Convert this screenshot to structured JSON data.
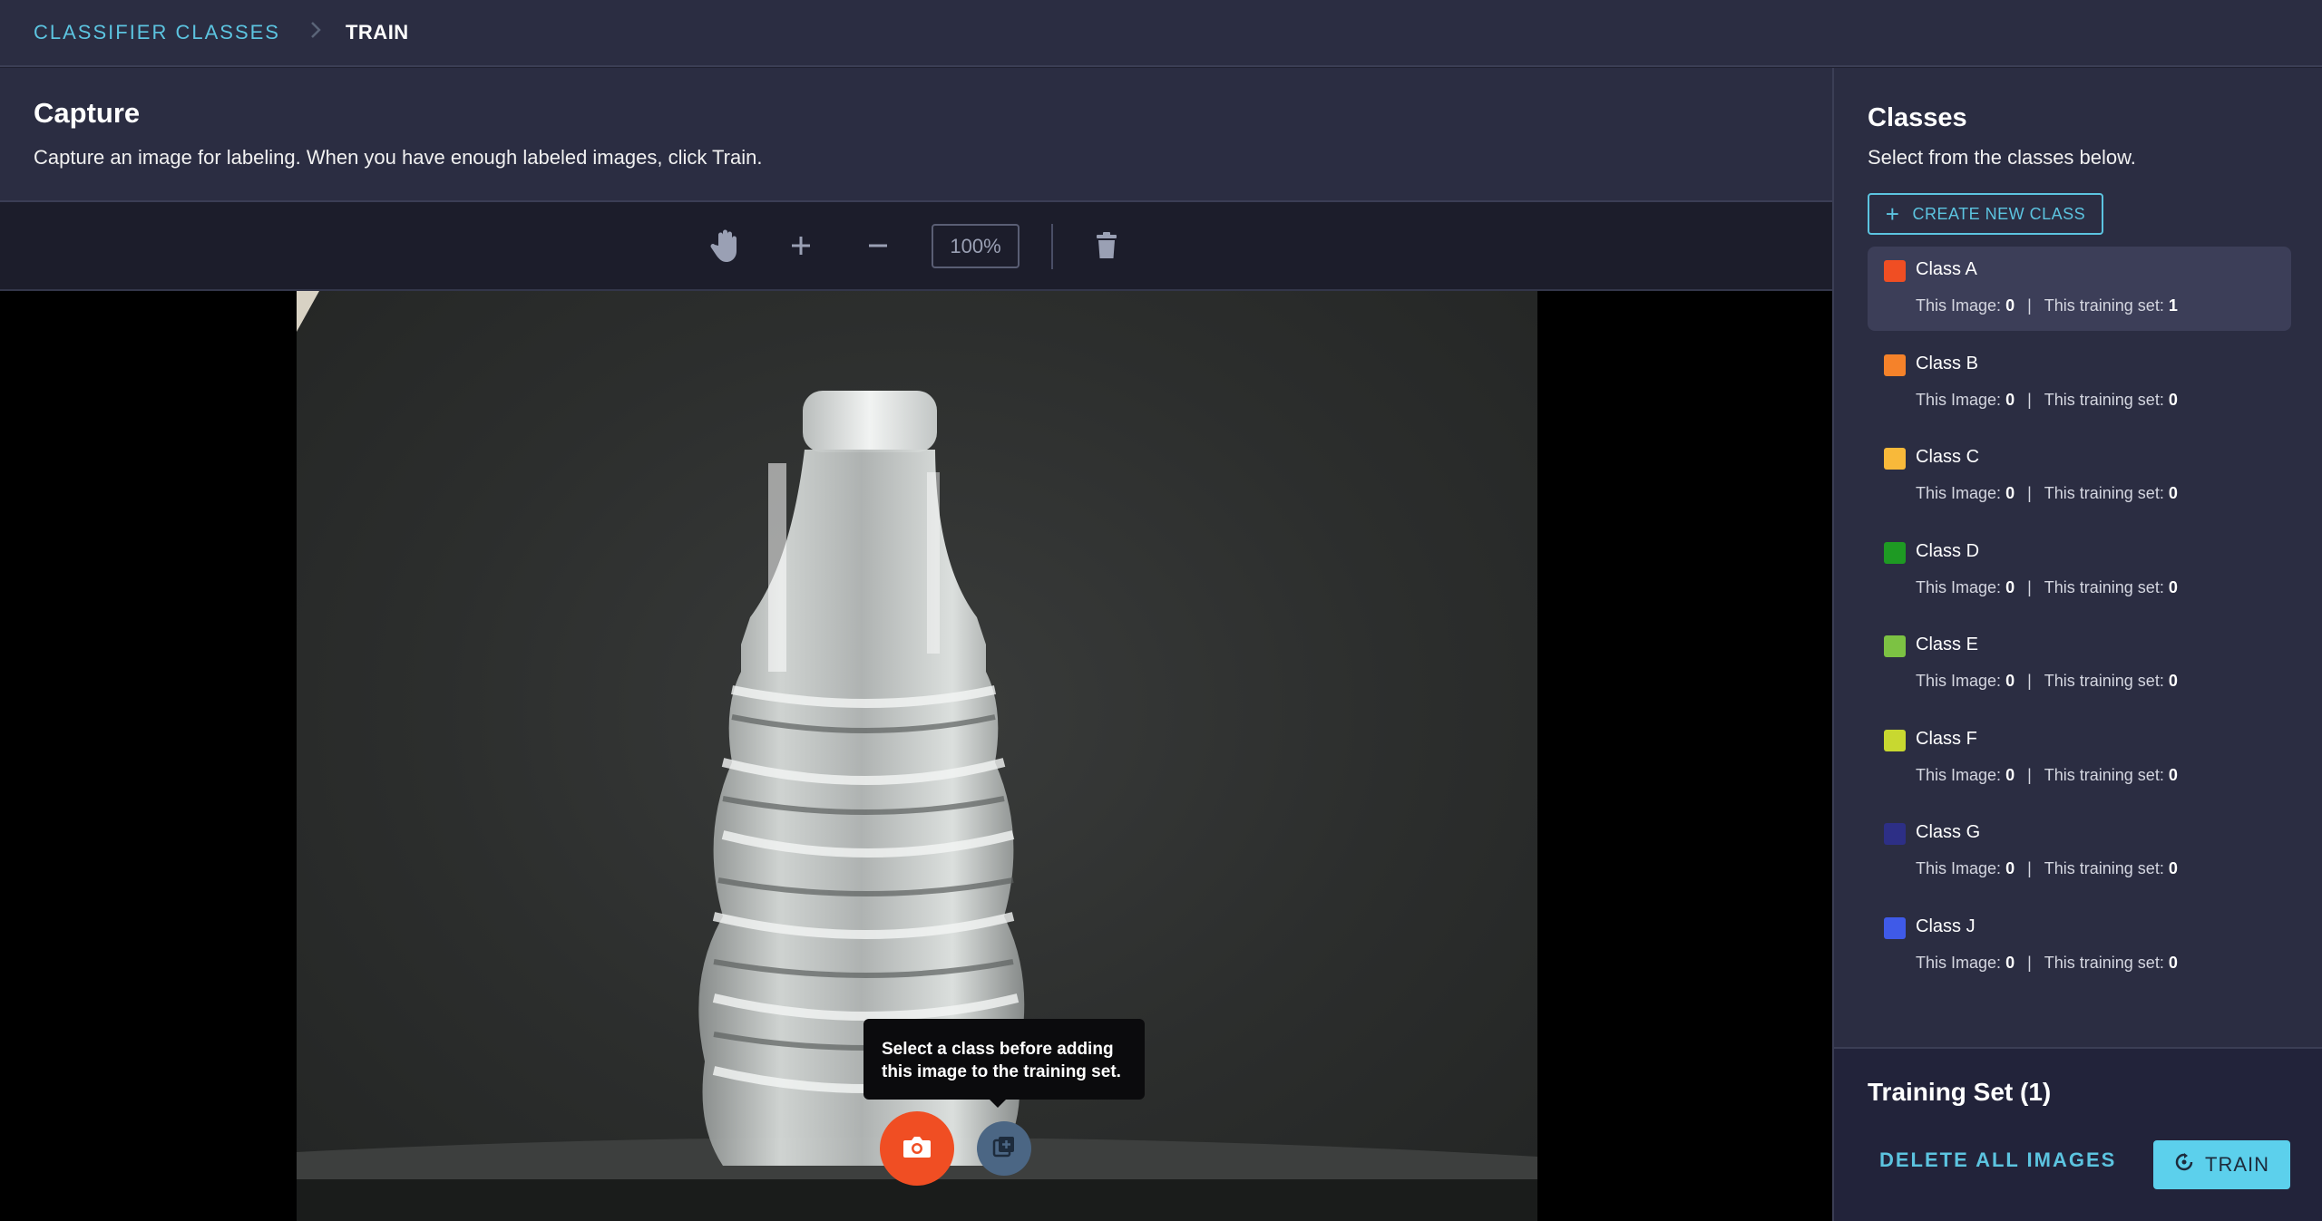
{
  "breadcrumb": {
    "parent": "CLASSIFIER CLASSES",
    "current": "TRAIN"
  },
  "capture": {
    "title": "Capture",
    "description": "Capture an image for labeling. When you have enough labeled images, click Train."
  },
  "toolbar": {
    "tools": [
      "hand-icon",
      "zoom-in-icon",
      "zoom-out-icon",
      "trash-icon"
    ],
    "zoom": "100%"
  },
  "viewer": {
    "tooltip_line1": "Select a class before adding",
    "tooltip_line2": "this image to the training set.",
    "capture_button_icon": "camera-icon",
    "add_button_icon": "add-to-set-icon"
  },
  "classes_panel": {
    "title": "Classes",
    "subtitle": "Select from the classes below.",
    "create_label": "CREATE NEW CLASS",
    "image_label": "This Image:",
    "set_label": "This training set:",
    "separator": "|",
    "items": [
      {
        "name": "Class A",
        "color": "#f04e23",
        "this_image": "0",
        "training_set": "1",
        "selected": true
      },
      {
        "name": "Class B",
        "color": "#f5822a",
        "this_image": "0",
        "training_set": "0",
        "selected": false
      },
      {
        "name": "Class C",
        "color": "#f8b93a",
        "this_image": "0",
        "training_set": "0",
        "selected": false
      },
      {
        "name": "Class D",
        "color": "#1e9a23",
        "this_image": "0",
        "training_set": "0",
        "selected": false
      },
      {
        "name": "Class E",
        "color": "#7cc243",
        "this_image": "0",
        "training_set": "0",
        "selected": false
      },
      {
        "name": "Class F",
        "color": "#c8d830",
        "this_image": "0",
        "training_set": "0",
        "selected": false
      },
      {
        "name": "Class G",
        "color": "#2d2f86",
        "this_image": "0",
        "training_set": "0",
        "selected": false
      },
      {
        "name": "Class J",
        "color": "#3f5ae8",
        "this_image": "0",
        "training_set": "0",
        "selected": false
      }
    ]
  },
  "training_set": {
    "title": "Training Set (1)",
    "delete_label": "DELETE ALL IMAGES",
    "train_label": "TRAIN"
  },
  "colors": {
    "accent": "#5cc4e0",
    "capture_button": "#f04e23",
    "panel_bg": "#2b2d42"
  }
}
